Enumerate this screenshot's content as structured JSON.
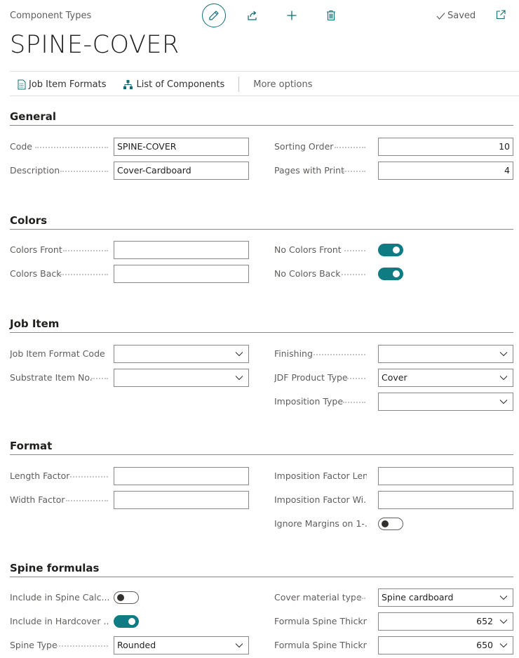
{
  "header": {
    "caption": "Component Types",
    "title": "SPINE-COVER",
    "status": "Saved",
    "icons": [
      "edit-icon",
      "share-icon",
      "new-icon",
      "delete-icon",
      "saved-check-icon",
      "popout-icon"
    ]
  },
  "actions": {
    "job_item_formats": "Job Item Formats",
    "list_of_components": "List of Components",
    "more_options": "More options"
  },
  "sections": {
    "general": {
      "title": "General",
      "code": {
        "label": "Code",
        "value": "SPINE-COVER"
      },
      "description": {
        "label": "Description",
        "value": "Cover-Cardboard"
      },
      "sorting_order": {
        "label": "Sorting Order",
        "value": "10"
      },
      "pages_with_print": {
        "label": "Pages with Print",
        "value": "4"
      }
    },
    "colors": {
      "title": "Colors",
      "colors_front": {
        "label": "Colors Front",
        "value": ""
      },
      "colors_back": {
        "label": "Colors Back",
        "value": ""
      },
      "no_colors_front": {
        "label": "No Colors Front",
        "on": true
      },
      "no_colors_back": {
        "label": "No Colors Back",
        "on": true
      }
    },
    "job_item": {
      "title": "Job Item",
      "job_item_format_code": {
        "label": "Job Item Format Code",
        "value": ""
      },
      "substrate_item_no": {
        "label": "Substrate Item No.",
        "value": ""
      },
      "finishing": {
        "label": "Finishing",
        "value": ""
      },
      "jdf_product_type": {
        "label": "JDF Product Type",
        "value": "Cover"
      },
      "imposition_type": {
        "label": "Imposition Type",
        "value": ""
      }
    },
    "format": {
      "title": "Format",
      "length_factor": {
        "label": "Length Factor",
        "value": ""
      },
      "width_factor": {
        "label": "Width Factor",
        "value": ""
      },
      "imposition_factor_length": {
        "label": "Imposition Factor Len...",
        "value": ""
      },
      "imposition_factor_width": {
        "label": "Imposition Factor Wi...",
        "value": ""
      },
      "ignore_margins": {
        "label": "Ignore Margins on 1-...",
        "on": false
      }
    },
    "spine": {
      "title": "Spine formulas",
      "include_spine_calc": {
        "label": "Include in Spine Calc...",
        "on": false
      },
      "include_hardcover": {
        "label": "Include in Hardcover ...",
        "on": true
      },
      "spine_type": {
        "label": "Spine Type",
        "value": "Rounded"
      },
      "cover_material_type": {
        "label": "Cover material type",
        "value": "Spine cardboard"
      },
      "formula_spine_thickness_1": {
        "label": "Formula Spine Thickn...",
        "value": "652"
      },
      "formula_spine_thickness_2": {
        "label": "Formula Spine Thickn...",
        "value": "650"
      }
    }
  },
  "colors": {
    "accent": "#0f7b83",
    "border": "#8a8886",
    "label": "#605e5c"
  }
}
